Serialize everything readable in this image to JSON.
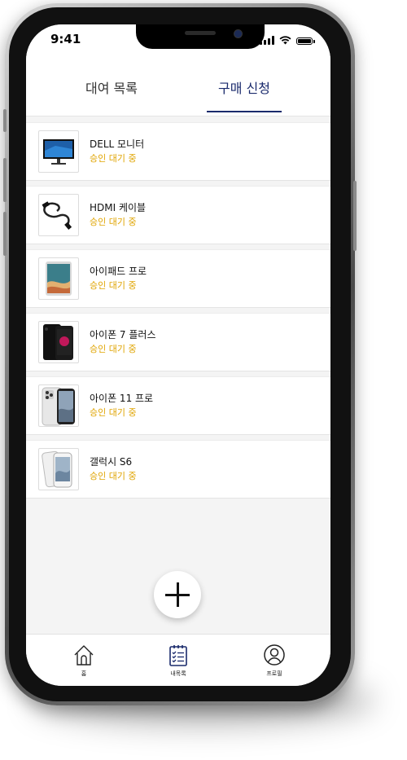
{
  "status_bar": {
    "time": "9:41"
  },
  "tabs": [
    {
      "label": "대여 목록",
      "active": false
    },
    {
      "label": "구매 신청",
      "active": true
    }
  ],
  "items": [
    {
      "name": "DELL 모니터",
      "status": "승인 대기 중",
      "image": "monitor-thumbnail"
    },
    {
      "name": "HDMI 케이블",
      "status": "승인 대기 중",
      "image": "cable-thumbnail"
    },
    {
      "name": "아이패드 프로",
      "status": "승인 대기 중",
      "image": "tablet-thumbnail"
    },
    {
      "name": "아이폰 7 플러스",
      "status": "승인 대기 중",
      "image": "phone-black-thumbnail"
    },
    {
      "name": "아이폰 11 프로",
      "status": "승인 대기 중",
      "image": "phone-silver-thumbnail"
    },
    {
      "name": "갤럭시 S6",
      "status": "승인 대기 중",
      "image": "phone-white-thumbnail"
    }
  ],
  "fab": {
    "icon": "plus-icon"
  },
  "bottom_nav": [
    {
      "label": "홈",
      "icon": "home-icon"
    },
    {
      "label": "내목록",
      "icon": "checklist-icon"
    },
    {
      "label": "프로필",
      "icon": "profile-icon"
    }
  ],
  "colors": {
    "accent": "#1a2a6c",
    "pending": "#e0a400",
    "background": "#f4f4f4"
  }
}
